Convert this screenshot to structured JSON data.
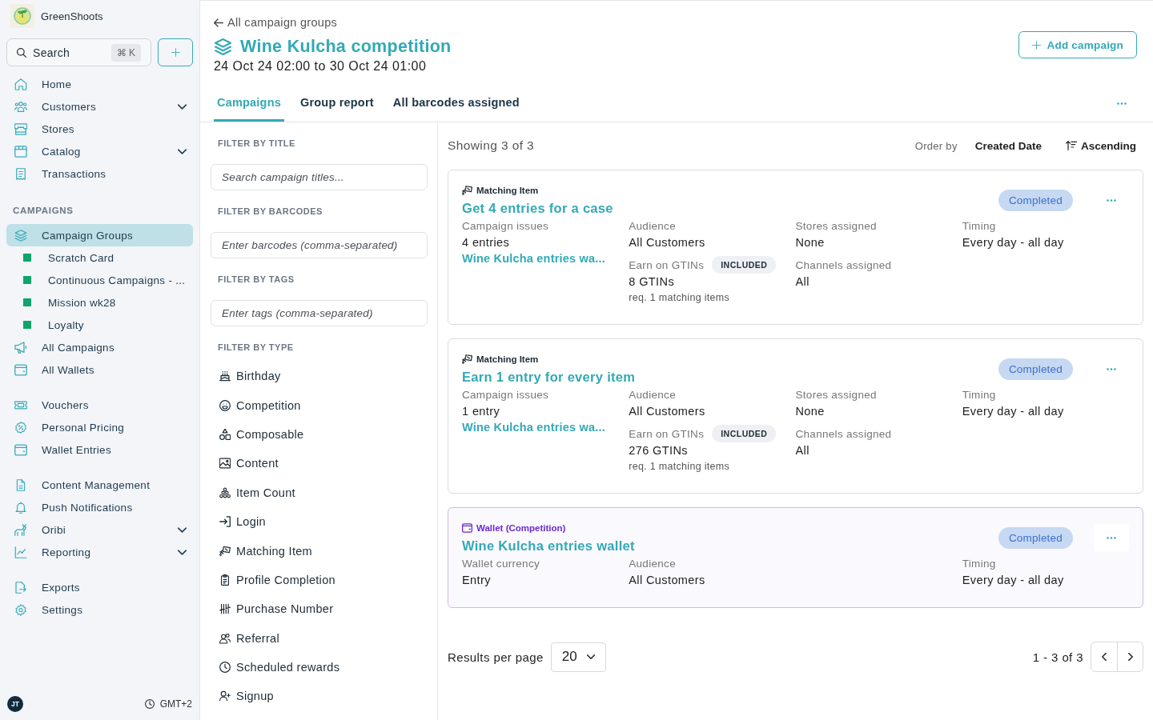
{
  "brand": {
    "name": "GreenShoots"
  },
  "search": {
    "label": "Search",
    "shortcut": "⌘ K"
  },
  "sidebar": {
    "groups": [
      {
        "items": [
          {
            "label": "Home",
            "kind": "link",
            "selected": false
          },
          {
            "label": "Customers",
            "kind": "menu",
            "expanded": false,
            "selected": false
          },
          {
            "label": "Stores",
            "kind": "link",
            "selected": false
          },
          {
            "label": "Catalog",
            "kind": "menu",
            "expanded": false,
            "selected": false
          },
          {
            "label": "Transactions",
            "kind": "link",
            "selected": false
          }
        ]
      },
      {
        "heading": "CAMPAIGNS",
        "items": [
          {
            "label": "Campaign Groups",
            "kind": "link",
            "selected": true,
            "children": [
              {
                "label": "Scratch Card",
                "color": "#0fa46c",
                "selected": false
              },
              {
                "label": "Continuous Campaigns - ...",
                "color": "#0fa46c",
                "selected": false
              },
              {
                "label": "Mission wk28",
                "color": "#0fa46c",
                "selected": false
              },
              {
                "label": "Loyalty",
                "color": "#0fa46c",
                "selected": false
              }
            ]
          },
          {
            "label": "All Campaigns",
            "kind": "link",
            "selected": false
          },
          {
            "label": "All Wallets",
            "kind": "link",
            "selected": false
          }
        ]
      },
      {
        "items": [
          {
            "label": "Vouchers",
            "kind": "link",
            "selected": false
          },
          {
            "label": "Personal Pricing",
            "kind": "link",
            "selected": false
          },
          {
            "label": "Wallet Entries",
            "kind": "link",
            "selected": false
          }
        ]
      },
      {
        "items": [
          {
            "label": "Content Management",
            "kind": "link",
            "selected": false
          },
          {
            "label": "Push Notifications",
            "kind": "link",
            "selected": false
          },
          {
            "label": "Oribi",
            "kind": "menu",
            "expanded": false,
            "selected": false
          },
          {
            "label": "Reporting",
            "kind": "menu",
            "expanded": false,
            "selected": false
          }
        ]
      },
      {
        "items": [
          {
            "label": "Exports",
            "kind": "link",
            "selected": false
          },
          {
            "label": "Settings",
            "kind": "link",
            "selected": false
          }
        ]
      }
    ],
    "user": {
      "initials": "JT"
    },
    "timezone": "GMT+2"
  },
  "header": {
    "back_link": "All campaign groups",
    "title": "Wine Kulcha competition",
    "dates": "24 Oct 24 02:00 to 30 Oct 24 01:00",
    "action": "Add campaign"
  },
  "tabs": [
    {
      "label": "Campaigns",
      "selected": true
    },
    {
      "label": "Group report",
      "selected": false
    },
    {
      "label": "All barcodes assigned",
      "selected": false
    }
  ],
  "filters": {
    "fields": [
      {
        "heading": "FILTER BY TITLE",
        "placeholder": "Search campaign titles..."
      },
      {
        "heading": "FILTER BY BARCODES",
        "placeholder": "Enter barcodes (comma-separated)"
      },
      {
        "heading": "FILTER BY TAGS",
        "placeholder": "Enter tags (comma-separated)"
      }
    ],
    "type_heading": "FILTER BY TYPE",
    "types": [
      {
        "label": "Birthday",
        "selected": false
      },
      {
        "label": "Competition",
        "selected": false
      },
      {
        "label": "Composable",
        "selected": false
      },
      {
        "label": "Content",
        "selected": false
      },
      {
        "label": "Item Count",
        "selected": false
      },
      {
        "label": "Login",
        "selected": false
      },
      {
        "label": "Matching Item",
        "selected": false
      },
      {
        "label": "Profile Completion",
        "selected": false
      },
      {
        "label": "Purchase Number",
        "selected": false
      },
      {
        "label": "Referral",
        "selected": false
      },
      {
        "label": "Scheduled rewards",
        "selected": false
      },
      {
        "label": "Signup",
        "selected": false
      }
    ]
  },
  "results": {
    "summary": "Showing 3 of 3",
    "order_label": "Order by",
    "order_field": "Created Date",
    "direction": "Ascending"
  },
  "campaigns": [
    {
      "kind": "matching",
      "type": "Matching Item",
      "title": "Get 4 entries for a case",
      "status": "Completed",
      "fields": [
        {
          "kind": "issues",
          "label": "Campaign issues",
          "value": "4 entries",
          "link": "Wine Kulcha entries wa..."
        },
        {
          "kind": "audience",
          "label": "Audience",
          "value": "All Customers"
        },
        {
          "kind": "gtins",
          "label": "Earn on GTINs",
          "badge": "INCLUDED",
          "value": "8 GTINs",
          "note": "req. 1 matching items"
        },
        {
          "kind": "stores",
          "label": "Stores assigned",
          "value": "None"
        },
        {
          "kind": "channels",
          "label": "Channels assigned",
          "value": "All"
        },
        {
          "kind": "timing",
          "label": "Timing",
          "value": "Every day - all day"
        }
      ]
    },
    {
      "kind": "matching",
      "type": "Matching Item",
      "title": "Earn 1 entry for every item",
      "status": "Completed",
      "fields": [
        {
          "kind": "issues",
          "label": "Campaign issues",
          "value": "1 entry",
          "link": "Wine Kulcha entries wa..."
        },
        {
          "kind": "audience",
          "label": "Audience",
          "value": "All Customers"
        },
        {
          "kind": "gtins",
          "label": "Earn on GTINs",
          "badge": "INCLUDED",
          "value": "276 GTINs",
          "note": "req. 1 matching items"
        },
        {
          "kind": "stores",
          "label": "Stores assigned",
          "value": "None"
        },
        {
          "kind": "channels",
          "label": "Channels assigned",
          "value": "All"
        },
        {
          "kind": "timing",
          "label": "Timing",
          "value": "Every day - all day"
        }
      ]
    },
    {
      "kind": "wallet",
      "type": "Wallet (Competition)",
      "title": "Wine Kulcha entries wallet",
      "status": "Completed",
      "fields": [
        {
          "kind": "currency",
          "label": "Wallet currency",
          "value": "Entry"
        },
        {
          "kind": "audience",
          "label": "Audience",
          "value": "All Customers"
        },
        {
          "kind": "timing",
          "label": "Timing",
          "value": "Every day - all day"
        }
      ]
    }
  ],
  "pagination": {
    "per_page_label": "Results per page",
    "per_page": "20",
    "range": "1 - 3 of 3"
  }
}
